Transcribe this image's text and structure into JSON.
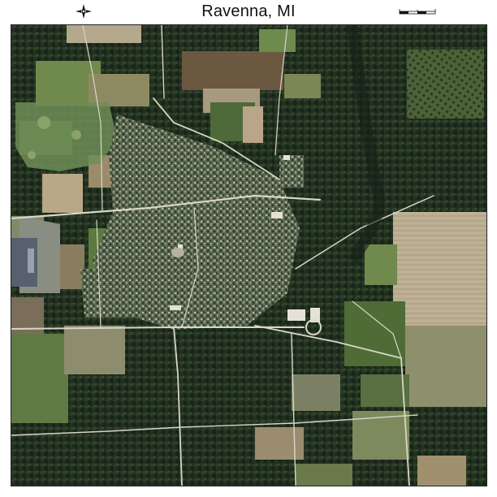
{
  "map": {
    "title": "Ravenna, MI",
    "type": "aerial photograph",
    "north_arrow_icon": "north-arrow-icon",
    "scale_bar_icon": "scale-bar-icon",
    "colors": {
      "forest": "#1f2d1c",
      "field_green": "#5f7a45",
      "field_tan": "#b9ab8f",
      "field_brown": "#7d6a4e",
      "town": "#6d7262",
      "road": "#d8d6c9"
    }
  }
}
